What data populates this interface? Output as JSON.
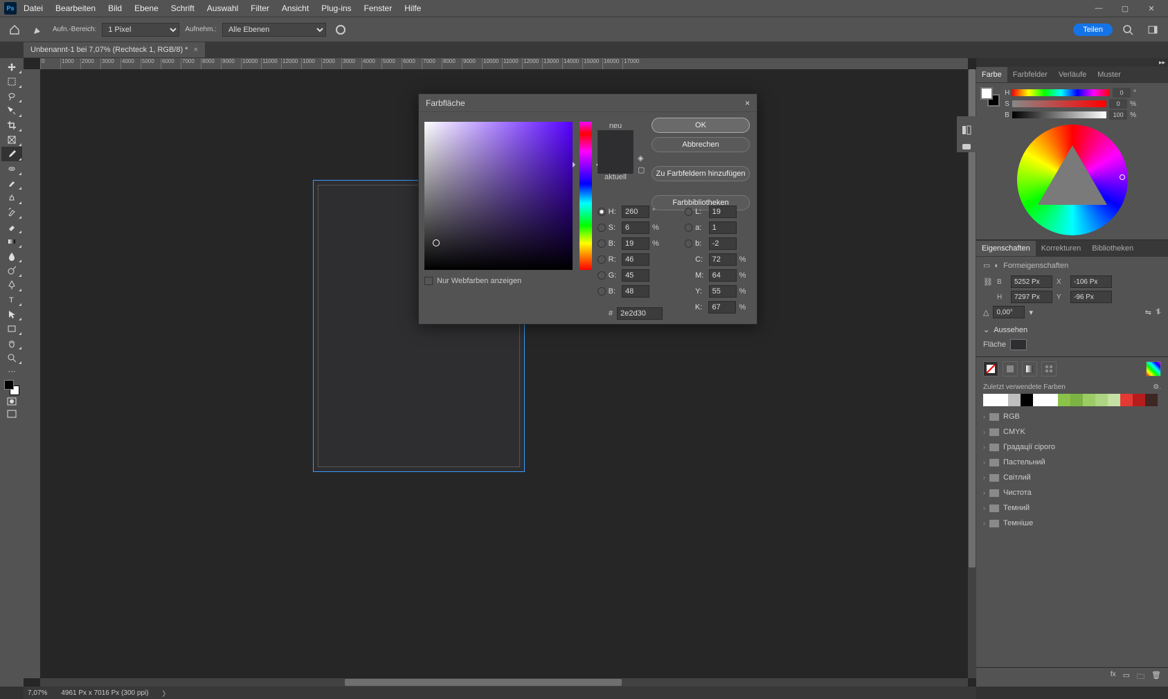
{
  "app": {
    "logo": "Ps"
  },
  "menu": [
    "Datei",
    "Bearbeiten",
    "Bild",
    "Ebene",
    "Schrift",
    "Auswahl",
    "Filter",
    "Ansicht",
    "Plug-ins",
    "Fenster",
    "Hilfe"
  ],
  "options": {
    "label1": "Aufn.-Bereich:",
    "sel1": "1 Pixel",
    "label2": "Aufnehm.:",
    "sel2": "Alle Ebenen",
    "teilen": "Teilen"
  },
  "doc": {
    "tab": "Unbenannt-1 bei 7,07% (Rechteck 1, RGB/8) *"
  },
  "ruler_ticks": [
    "0",
    "1000",
    "2000",
    "3000",
    "4000",
    "5000",
    "6000",
    "7000",
    "8000",
    "9000",
    "10000",
    "11000",
    "12000",
    "1000",
    "2000",
    "3000",
    "4000",
    "5000",
    "6000",
    "7000",
    "8000",
    "9000",
    "10000",
    "11000",
    "12000",
    "13000",
    "14000",
    "15000",
    "16000",
    "17000"
  ],
  "status": {
    "zoom": "7,07%",
    "dims": "4961 Px x 7016 Px (300 ppi)"
  },
  "dialog": {
    "title": "Farbfläche",
    "neu": "neu",
    "aktuell": "aktuell",
    "ok": "OK",
    "cancel": "Abbrechen",
    "add": "Zu Farbfeldern hinzufügen",
    "lib": "Farbbibliotheken",
    "H": "260",
    "S": "6",
    "Bv": "19",
    "L": "19",
    "a": "1",
    "b": "-2",
    "R": "46",
    "G": "45",
    "Bc": "48",
    "C": "72",
    "M": "64",
    "Y": "55",
    "K": "67",
    "hex": "2e2d30",
    "webonly": "Nur Webfarben anzeigen",
    "deg": "°",
    "pct": "%"
  },
  "panel": {
    "color_tabs": [
      "Farbe",
      "Farbfelder",
      "Verläufe",
      "Muster"
    ],
    "hsb": {
      "H": "0",
      "S": "0",
      "B": "100"
    },
    "props_tabs": [
      "Eigenschaften",
      "Korrekturen",
      "Bibliotheken"
    ],
    "props_title": "Formeigenschaften",
    "B": "5252 Px",
    "X": "-106 Px",
    "H": "7297 Px",
    "Y": "-96 Px",
    "rot": "0,00°",
    "aussehen": "Aussehen",
    "fill": "Fläche",
    "recent": "Zuletzt verwendete Farben",
    "recent_colors": [
      "#ffffff",
      "#ffffff",
      "#bfbfbf",
      "#000000",
      "#ffffff",
      "#ffffff",
      "#8bc34a",
      "#7cb342",
      "#9ccc65",
      "#aed581",
      "#c5e1a5",
      "#e53935",
      "#b71c1c",
      "#3e2723"
    ],
    "folders": [
      "RGB",
      "CMYK",
      "Градації сірого",
      "Пастельний",
      "Світлий",
      "Чистота",
      "Темний",
      "Темніше"
    ]
  }
}
